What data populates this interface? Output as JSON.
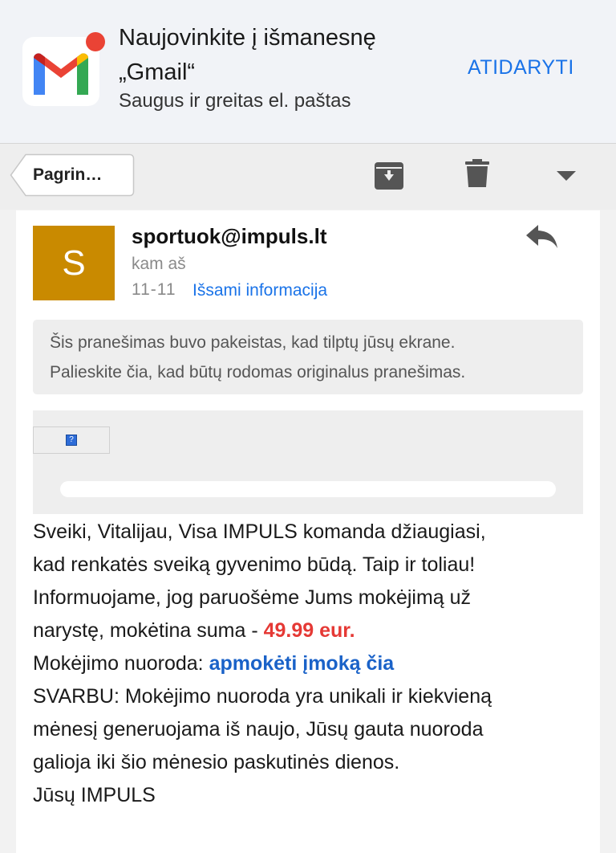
{
  "banner": {
    "title": "Naujovinkite į išmanesnę „Gmail“",
    "subtitle": "Saugus ir greitas el. paštas",
    "open_label": "ATIDARYTI",
    "icon": "gmail-app-icon"
  },
  "toolbar": {
    "back_label": "Pagrin…",
    "icons": [
      "archive-icon",
      "trash-icon",
      "dropdown-arrow-icon"
    ]
  },
  "message": {
    "avatar_letter": "S",
    "sender": "sportuok@impuls.lt",
    "to": "kam aš",
    "date": "11-11",
    "details_link": "Išsami informacija",
    "notice_line1": "Šis pranešimas buvo pakeistas, kad tilptų jūsų ekrane.",
    "notice_line2": "Palieskite čia, kad būtų rodomas originalus pranešimas.",
    "broken_image_glyph": "?",
    "body": {
      "line1": "Sveiki, Vitalijau, Visa IMPULS komanda džiaugiasi,",
      "line2": "kad renkatės sveiką gyvenimo būdą. Taip ir toliau!",
      "line3": "Informuojame, jog paruošėme Jums mokėjimą už",
      "line4_prefix": "narystę, mokėtina suma - ",
      "amount": "49.99 eur.",
      "payment_label": "Mokėjimo nuoroda: ",
      "payment_link": "apmokėti įmoką čia",
      "important1": "SVARBU: Mokėjimo nuoroda yra unikali ir kiekvieną",
      "important2": "mėnesį generuojama iš naujo, Jūsų gauta nuoroda",
      "important3": "galioja iki šio mėnesio paskutinės dienos.",
      "signature": "Jūsų IMPULS"
    }
  },
  "colors": {
    "accent_blue": "#1a73e8",
    "avatar_bg": "#c98a00",
    "amount_red": "#e53935",
    "notification_dot": "#ea4335"
  }
}
